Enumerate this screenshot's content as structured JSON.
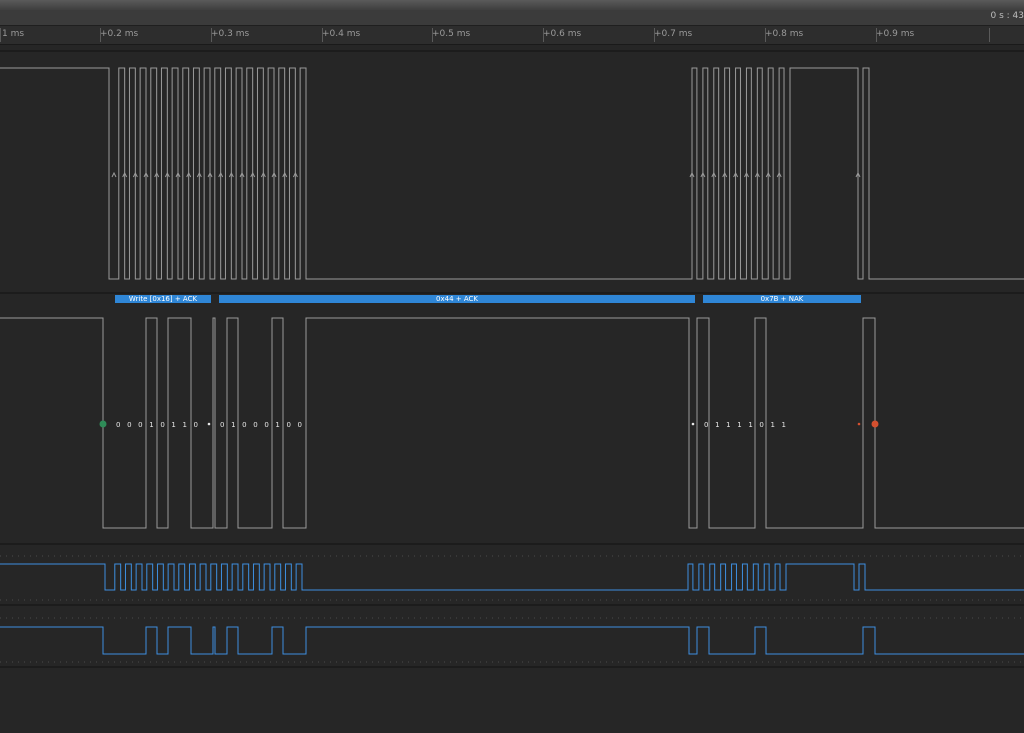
{
  "window": {
    "time_readout": "0 s : 43"
  },
  "ruler": {
    "ticks": [
      {
        "label": "1 ms"
      },
      {
        "label": "+0.2 ms"
      },
      {
        "label": "+0.3 ms"
      },
      {
        "label": "+0.4 ms"
      },
      {
        "label": "+0.5 ms"
      },
      {
        "label": "+0.6 ms"
      },
      {
        "label": "+0.7 ms"
      },
      {
        "label": "+0.8 ms"
      },
      {
        "label": "+0.9 ms"
      }
    ]
  },
  "decoder": {
    "frames": [
      {
        "label": "Write [0x16] + ACK"
      },
      {
        "label": "0x44 + ACK"
      },
      {
        "label": "0x7B + NAK"
      }
    ]
  },
  "bits": {
    "group1": "0 0 0 1 0 1 1 0",
    "group2": "0 1 0 0 0 1 0 0",
    "group3": "0 1 1 1 1 0 1 1"
  },
  "colors": {
    "background": "#262626",
    "digital_trace": "#9b9b9b",
    "analog_trace": "#3d8fe0",
    "decoder_bar": "#2f86d6",
    "start_marker": "#2e8b57",
    "stop_marker": "#d4502f"
  }
}
